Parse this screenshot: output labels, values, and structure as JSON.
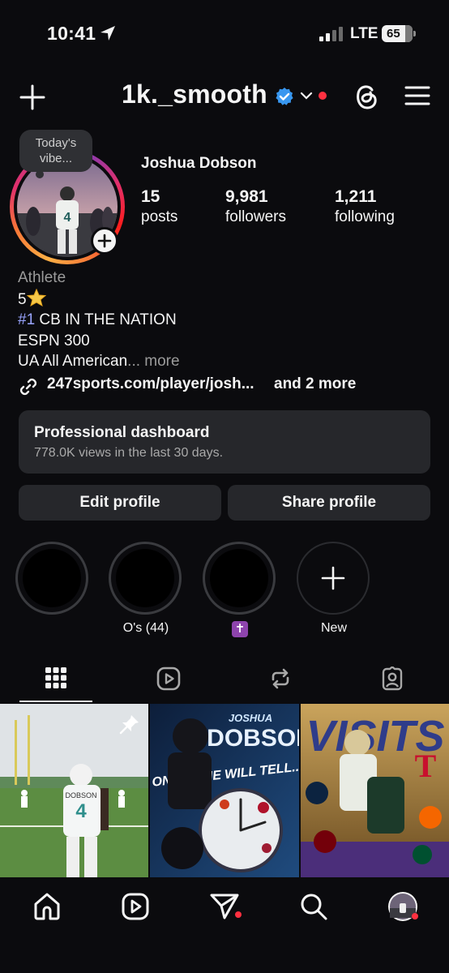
{
  "status_bar": {
    "time": "10:41",
    "network": "LTE",
    "battery": "65"
  },
  "header": {
    "username": "1k._smooth"
  },
  "profile": {
    "note": "Today's vibe...",
    "full_name": "Joshua Dobson",
    "stats": [
      {
        "value": "15",
        "label": "posts"
      },
      {
        "value": "9,981",
        "label": "followers"
      },
      {
        "value": "1,211",
        "label": "following"
      }
    ],
    "bio": {
      "category": "Athlete",
      "line1": "5",
      "line2_tag": "#1",
      "line2_rest": " CB IN THE NATION",
      "line3": "ESPN 300",
      "line4": "UA All American",
      "more": "... more"
    },
    "link": "247sports.com/player/josh...",
    "link_more": "and 2 more"
  },
  "dashboard": {
    "title": "Professional dashboard",
    "subtitle": "778.0K views in the last 30 days."
  },
  "buttons": {
    "edit": "Edit profile",
    "share": "Share profile"
  },
  "highlights": [
    {
      "label": ""
    },
    {
      "label": "O's (44)"
    },
    {
      "label": "✝"
    },
    {
      "label": "New"
    }
  ],
  "grid_posts": [
    {
      "jersey_name": "DOBSON",
      "jersey_number": "4"
    },
    {
      "title_line1": "JOSHUA",
      "title_line2": "DOBSON",
      "slogan": "ONLY TIME WILL TELL..."
    },
    {
      "title": "VISITS"
    }
  ],
  "colors": {
    "accent_link": "#9aa5ff",
    "verified": "#3897f0",
    "notification": "#ff3040",
    "surface": "#26272b"
  }
}
